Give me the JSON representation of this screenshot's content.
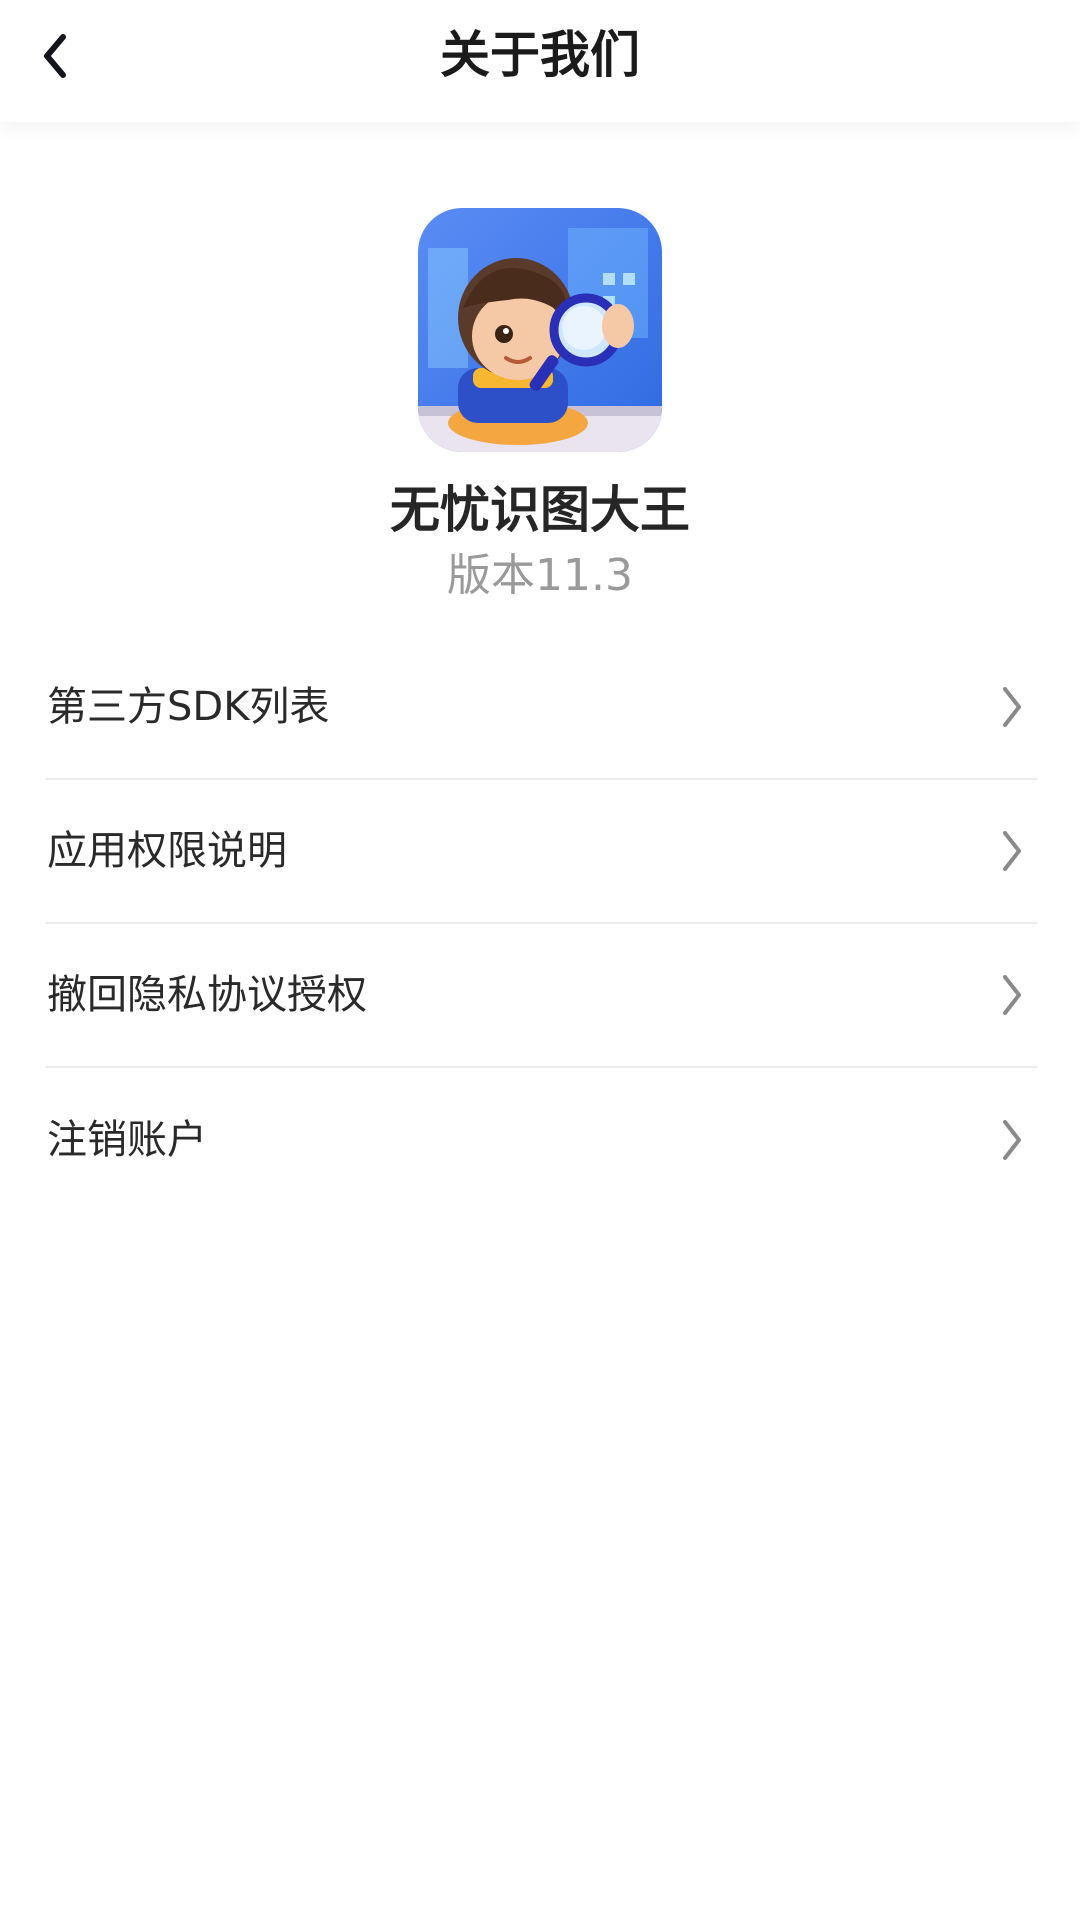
{
  "header": {
    "title": "关于我们",
    "back_icon": "back-arrow-icon"
  },
  "app": {
    "name": "无忧识图大王",
    "version": "版本11.3",
    "logo_icon": "app-logo-boy-with-magnifier"
  },
  "menu": {
    "items": [
      {
        "label": "第三方SDK列表",
        "icon": "chevron-right-icon"
      },
      {
        "label": "应用权限说明",
        "icon": "chevron-right-icon"
      },
      {
        "label": "撤回隐私协议授权",
        "icon": "chevron-right-icon"
      },
      {
        "label": "注销账户",
        "icon": "chevron-right-icon"
      }
    ]
  },
  "colors": {
    "background": "#ffffff",
    "title": "#1b1b1b",
    "version": "#9a9a9a",
    "divider": "#ececec",
    "chevron": "#8a8a8a"
  }
}
